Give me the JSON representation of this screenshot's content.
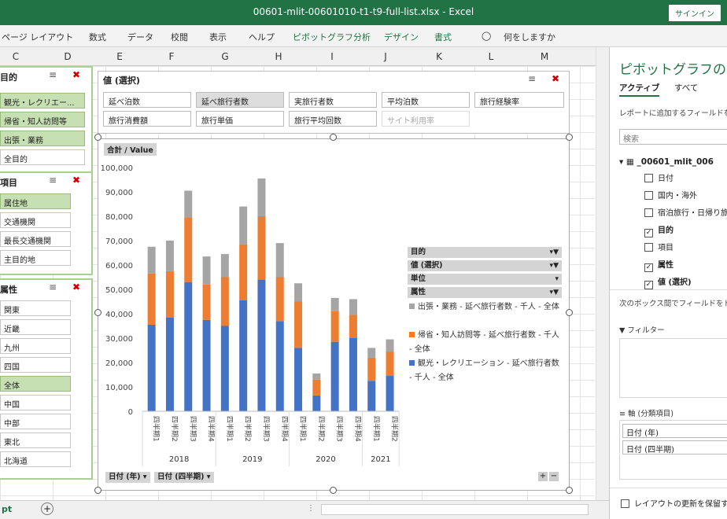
{
  "window": {
    "title": "00601-mlit-00601010-t1-t9-full-list.xlsx  -  Excel",
    "signin": "サインイン"
  },
  "ribbon": [
    "ページ レイアウト",
    "数式",
    "データ",
    "校閲",
    "表示",
    "ヘルプ",
    "ピボットグラフ分析",
    "デザイン",
    "書式",
    "何をしますか"
  ],
  "columns": [
    "C",
    "D",
    "E",
    "F",
    "G",
    "H",
    "I",
    "J",
    "K",
    "L",
    "M"
  ],
  "slicers": [
    {
      "title": "目的",
      "items": [
        {
          "label": "観光・レクリエー...",
          "sel": true
        },
        {
          "label": "帰省・知人訪問等",
          "sel": true
        },
        {
          "label": "出張・業務",
          "sel": true
        },
        {
          "label": "全目的",
          "sel": false
        }
      ]
    },
    {
      "title": "項目",
      "items": [
        {
          "label": "属住地",
          "sel": true
        },
        {
          "label": "交通機関",
          "sel": false
        },
        {
          "label": "最長交通機関",
          "sel": false
        },
        {
          "label": "主目的地",
          "sel": false
        }
      ]
    },
    {
      "title": "属性",
      "items": [
        {
          "label": "関東",
          "sel": false
        },
        {
          "label": "近畿",
          "sel": false
        },
        {
          "label": "九州",
          "sel": false
        },
        {
          "label": "四国",
          "sel": false
        },
        {
          "label": "全体",
          "sel": true
        },
        {
          "label": "中国",
          "sel": false
        },
        {
          "label": "中部",
          "sel": false
        },
        {
          "label": "東北",
          "sel": false
        },
        {
          "label": "北海道",
          "sel": false
        }
      ]
    }
  ],
  "chart": {
    "filter_title": "値 (選択)",
    "field_buttons": [
      {
        "label": "延べ泊数",
        "state": ""
      },
      {
        "label": "延べ旅行者数",
        "state": "sel"
      },
      {
        "label": "実旅行者数",
        "state": ""
      },
      {
        "label": "平均泊数",
        "state": ""
      },
      {
        "label": "旅行経験率",
        "state": ""
      },
      {
        "label": "旅行消費額",
        "state": ""
      },
      {
        "label": "旅行単価",
        "state": ""
      },
      {
        "label": "旅行平均回数",
        "state": ""
      },
      {
        "label": "サイト利用率",
        "state": "dim"
      }
    ],
    "value_label": "合計 / Value",
    "legend_fields": [
      "目的",
      "値 (選択)",
      "単位",
      "属性"
    ],
    "axis_buttons": [
      "日付 (年)",
      "日付 (四半期)"
    ]
  },
  "chart_data": {
    "type": "bar",
    "stacked": true,
    "categories": [
      "四半期1",
      "四半期2",
      "四半期3",
      "四半期4",
      "四半期1",
      "四半期2",
      "四半期3",
      "四半期4",
      "四半期1",
      "四半期2",
      "四半期3",
      "四半期4",
      "四半期1",
      "四半期2"
    ],
    "groups": [
      {
        "label": "2018",
        "count": 4
      },
      {
        "label": "2019",
        "count": 4
      },
      {
        "label": "2020",
        "count": 4
      },
      {
        "label": "2021",
        "count": 2
      }
    ],
    "series": [
      {
        "name": "観光・レクリエーション - 延べ旅行者数 - 千人 - 全体",
        "color": "#4472c4",
        "values": [
          35500,
          38500,
          53000,
          37500,
          35000,
          45500,
          54000,
          37000,
          26000,
          6500,
          28500,
          30000,
          12500,
          14500
        ]
      },
      {
        "name": "帰省・知人訪問等 - 延べ旅行者数 - 千人 - 全体",
        "color": "#ed7d31",
        "values": [
          21000,
          19000,
          26500,
          14500,
          20000,
          23000,
          26000,
          18000,
          19000,
          6500,
          12500,
          9500,
          9500,
          10000
        ]
      },
      {
        "name": "出張・業務 - 延べ旅行者数 - 千人 - 全体",
        "color": "#a5a5a5",
        "values": [
          11000,
          12500,
          11000,
          11500,
          9500,
          15500,
          15500,
          14000,
          7500,
          2500,
          5500,
          6500,
          4000,
          5000
        ]
      }
    ],
    "yticks": [
      "100,000",
      "90,000",
      "80,000",
      "70,000",
      "60,000",
      "50,000",
      "40,000",
      "30,000",
      "20,000",
      "10,000",
      "0"
    ],
    "ylim": [
      0,
      100000
    ]
  },
  "panel": {
    "title": "ピボットグラフのフィ",
    "tabs": [
      "アクティブ",
      "すべて"
    ],
    "hint": "レポートに追加するフィールドを選",
    "search": "検索",
    "table_name": "_00601_mlit_006",
    "fields": [
      {
        "label": "日付",
        "on": false
      },
      {
        "label": "国内・海外",
        "on": false
      },
      {
        "label": "宿泊旅行・日帰り旅",
        "on": false
      },
      {
        "label": "目的",
        "on": true
      },
      {
        "label": "項目",
        "on": false
      },
      {
        "label": "属性",
        "on": true
      },
      {
        "label": "値 (選択)",
        "on": true
      }
    ],
    "drag_hint": "次のボックス間でフィールドをドラ",
    "filter_label": "フィルター",
    "axis_label": "軸 (分類項目)",
    "axis_items": [
      "日付 (年)",
      "日付 (四半期)"
    ],
    "defer": "レイアウトの更新を保留する"
  },
  "sheet_tab": "pt"
}
